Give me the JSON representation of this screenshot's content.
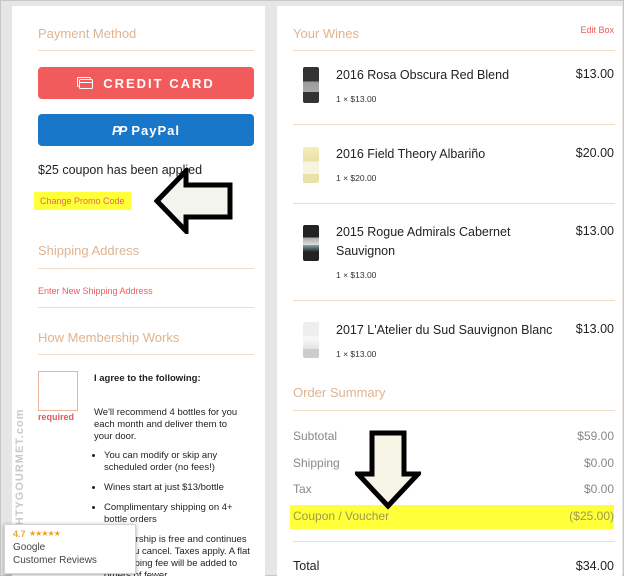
{
  "payment": {
    "title": "Payment Method",
    "credit_label": "CREDIT CARD",
    "paypal_label": "PayPal",
    "coupon_status": "$25 coupon has been applied",
    "change_promo": "Change Promo Code"
  },
  "shipping": {
    "title": "Shipping Address",
    "new_address_link": "Enter New Shipping Address"
  },
  "membership": {
    "title": "How Membership Works",
    "required": "required",
    "agree": "I agree to the following:",
    "recommend": "We'll recommend 4 bottles for you each month and deliver them to your door.",
    "bullets": [
      "You can modify or skip any scheduled order (no fees!)",
      "Wines start at just $13/bottle",
      "Complimentary shipping on 4+ bottle orders",
      "Membership is free and continues until you cancel. Taxes apply. A flat $9 shipping fee will be added to orders of fewer"
    ]
  },
  "watermark": "MIGHTYGOURMET.com",
  "google_badge": {
    "rating": "4.7",
    "stars": "★★★★★",
    "brand": "Google",
    "label": "Customer Reviews"
  },
  "wines": {
    "title": "Your Wines",
    "edit_label": "Edit Box",
    "items": [
      {
        "name": "2016 Rosa Obscura Red Blend",
        "qty": "1 × $13.00",
        "price": "$13.00"
      },
      {
        "name": "2016 Field Theory Albariño",
        "qty": "1 × $20.00",
        "price": "$20.00"
      },
      {
        "name": "2015 Rogue Admirals Cabernet Sauvignon",
        "qty": "1 × $13.00",
        "price": "$13.00"
      },
      {
        "name": "2017 L'Atelier du Sud Sauvignon Blanc",
        "qty": "1 × $13.00",
        "price": "$13.00"
      }
    ]
  },
  "summary": {
    "title": "Order Summary",
    "subtotal_label": "Subtotal",
    "subtotal": "$59.00",
    "shipping_label": "Shipping",
    "shipping": "$0.00",
    "tax_label": "Tax",
    "tax": "$0.00",
    "coupon_label": "Coupon / Voucher",
    "coupon": "($25.00)",
    "total_label": "Total",
    "total": "$34.00"
  },
  "colors": {
    "accent": "#e0b48f",
    "credit": "#f25b5b",
    "paypal": "#1877c9",
    "highlight": "#ffff3a",
    "link": "#ef5b5b"
  }
}
